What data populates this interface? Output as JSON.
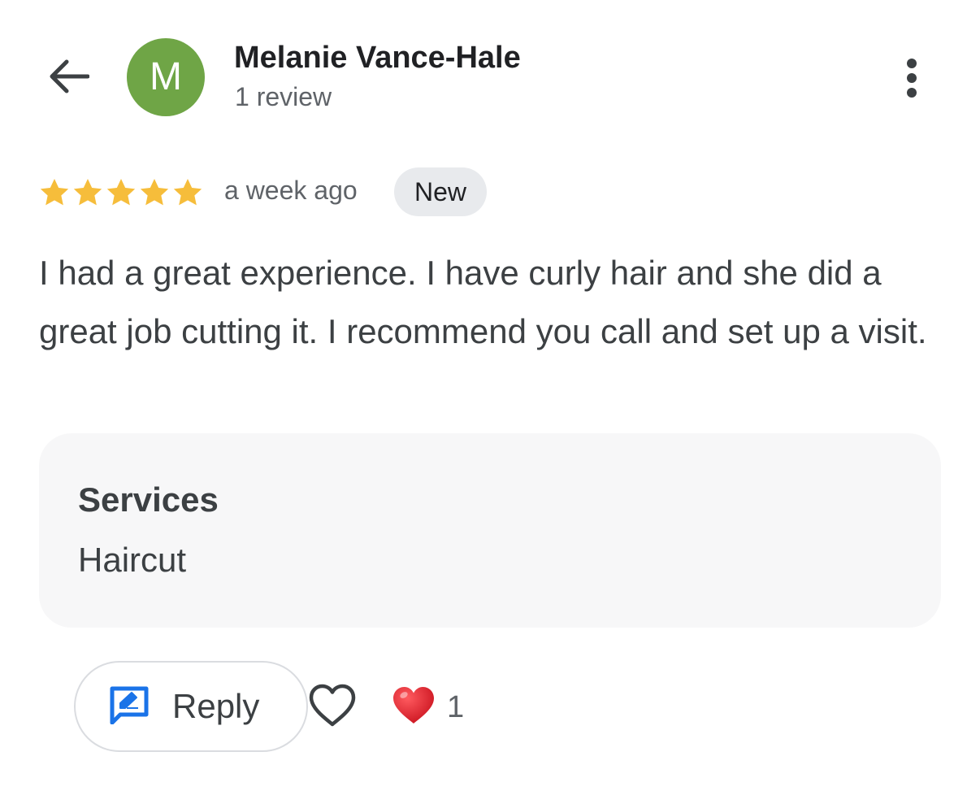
{
  "header": {
    "back_icon": "arrow-back-icon",
    "avatar_initial": "M",
    "avatar_color": "#6fa546",
    "reviewer_name": "Melanie Vance-Hale",
    "review_count": "1 review",
    "more_icon": "more-vert-icon"
  },
  "review": {
    "rating": 5,
    "rating_max": 5,
    "star_color": "#f6bd3b",
    "timestamp": "a week ago",
    "badge": "New",
    "text": "I had a great experience. I have curly hair and she did a great job cutting it. I recommend you call and set up a visit."
  },
  "services": {
    "title": "Services",
    "value": "Haircut"
  },
  "actions": {
    "reply_label": "Reply",
    "reply_icon": "edit-reply-icon",
    "reply_icon_color": "#1a73e8",
    "like_icon": "heart-outline-icon",
    "reaction_icon": "red-heart-icon",
    "reaction_color": "#e0222f",
    "reaction_count": "1"
  }
}
